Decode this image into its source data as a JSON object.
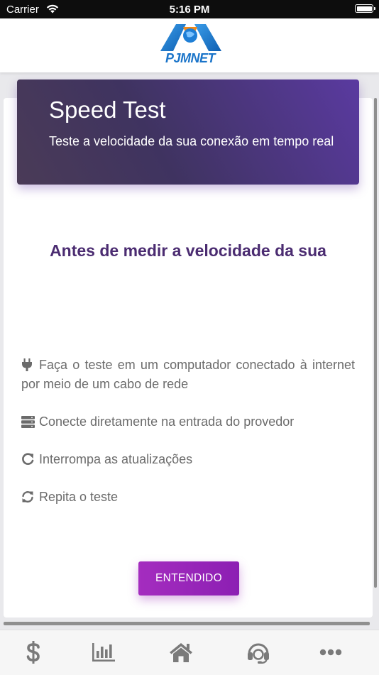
{
  "status_bar": {
    "carrier": "Carrier",
    "time": "5:16 PM"
  },
  "header": {
    "logo_text_main": "PJMNET",
    "logo_colors": {
      "blue": "#1a74c9",
      "orange": "#f08a1c"
    }
  },
  "hero": {
    "title": "Speed Test",
    "subtitle": "Teste a velocidade da sua conexão em tempo real"
  },
  "main": {
    "heading": "Antes de medir a velocidade da sua",
    "tips": [
      {
        "icon": "plug-icon",
        "text": "Faça o teste em um computador conectado à internet por meio de um cabo de rede"
      },
      {
        "icon": "server-icon",
        "text": "Conecte diretamente na entrada do provedor"
      },
      {
        "icon": "redo-icon",
        "text": "Interrompa as atualizações"
      },
      {
        "icon": "sync-icon",
        "text": "Repita o teste"
      }
    ],
    "button_label": "ENTENDIDO"
  },
  "tabbar": {
    "items": [
      {
        "icon": "dollar-icon"
      },
      {
        "icon": "bar-chart-icon"
      },
      {
        "icon": "home-icon"
      },
      {
        "icon": "headset-icon"
      },
      {
        "icon": "more-icon"
      }
    ]
  },
  "colors": {
    "accent_purple": "#4b2c71",
    "button_purple": "#9a27ba",
    "hero_gradient_start": "#4a3b57",
    "hero_gradient_end": "#5a3aa0"
  }
}
